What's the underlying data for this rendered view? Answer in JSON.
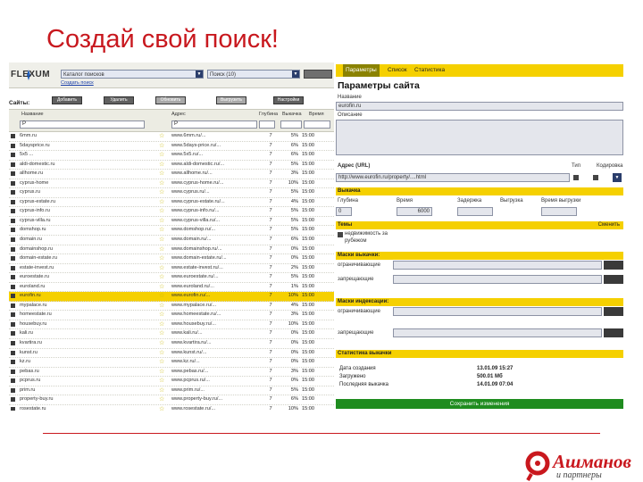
{
  "slide": {
    "title": "Создай свой поиск!"
  },
  "app": {
    "logo": "FLEXUM",
    "search_select": "Каталог поисков",
    "filter_select": "Поиск (10)",
    "go_label": "",
    "sublink": "Создать поиск"
  },
  "toolbar": {
    "label": "Сайты:",
    "buttons": [
      "Добавить",
      "Удалить",
      "Обновить",
      "Выгрузить",
      "Настройки"
    ]
  },
  "table": {
    "headers": [
      "Название",
      "Адрес",
      "Глубина",
      "Выкачка",
      "Время"
    ],
    "filter_icon": "Р",
    "rows": [
      {
        "name": "6mm.ru",
        "url": "www.6mm.ru/...",
        "count": "7",
        "pct": "5%",
        "time": "15:00"
      },
      {
        "name": "5daysprice.ru",
        "url": "www.5days-price.ru/...",
        "count": "7",
        "pct": "6%",
        "time": "15:00"
      },
      {
        "name": "5x5 ... ",
        "url": "www.5x5.ru/...",
        "count": "7",
        "pct": "6%",
        "time": "15:00"
      },
      {
        "name": "aldi-domestic.ru",
        "url": "www.aldi-domestic.ru/...",
        "count": "7",
        "pct": "5%",
        "time": "15:00"
      },
      {
        "name": "allhome.ru",
        "url": "www.allhome.ru/...",
        "count": "7",
        "pct": "3%",
        "time": "15:00"
      },
      {
        "name": "cyprus-home",
        "url": "www.cyprus-home.ru/...",
        "count": "7",
        "pct": "10%",
        "time": "15:00"
      },
      {
        "name": "cyprus.ru",
        "url": "www.cyprus.ru/...",
        "count": "7",
        "pct": "5%",
        "time": "15:00"
      },
      {
        "name": "cyprus-estate.ru",
        "url": "www.cyprus-estate.ru/...",
        "count": "7",
        "pct": "4%",
        "time": "15:00"
      },
      {
        "name": "cyprus-info.ru",
        "url": "www.cyprus-info.ru/...",
        "count": "7",
        "pct": "5%",
        "time": "15:00"
      },
      {
        "name": "cyprus-villa.ru",
        "url": "www.cyprus-villa.ru/...",
        "count": "7",
        "pct": "5%",
        "time": "15:00"
      },
      {
        "name": "domshop.ru",
        "url": "www.domshop.ru/...",
        "count": "7",
        "pct": "5%",
        "time": "15:00"
      },
      {
        "name": "domain.ru",
        "url": "www.domain.ru/...",
        "count": "7",
        "pct": "6%",
        "time": "15:00"
      },
      {
        "name": "domainshop.ru",
        "url": "www.domainshop.ru/...",
        "count": "7",
        "pct": "0%",
        "time": "15:00"
      },
      {
        "name": "domain-estate.ru",
        "url": "www.domain-estate.ru/...",
        "count": "7",
        "pct": "0%",
        "time": "15:00"
      },
      {
        "name": "estate-invest.ru",
        "url": "www.estate-invest.ru/...",
        "count": "7",
        "pct": "2%",
        "time": "15:00"
      },
      {
        "name": "euroestate.ru",
        "url": "www.euroestate.ru/...",
        "count": "7",
        "pct": "5%",
        "time": "15:00"
      },
      {
        "name": "euroland.ru",
        "url": "www.euroland.ru/...",
        "count": "7",
        "pct": "1%",
        "time": "15:00"
      },
      {
        "name": "eurofin.ru",
        "url": "www.eurofin.ru/...",
        "count": "7",
        "pct": "10%",
        "time": "15:00",
        "hl": true
      },
      {
        "name": "mypalace.ru",
        "url": "www.mypalace.ru/...",
        "count": "7",
        "pct": "4%",
        "time": "15:00"
      },
      {
        "name": "homeestate.ru",
        "url": "www.homeestate.ru/...",
        "count": "7",
        "pct": "3%",
        "time": "15:00"
      },
      {
        "name": "housebuy.ru",
        "url": "www.housebuy.ru/...",
        "count": "7",
        "pct": "10%",
        "time": "15:00"
      },
      {
        "name": "kali.ru",
        "url": "www.kali.ru/...",
        "count": "7",
        "pct": "0%",
        "time": "15:00"
      },
      {
        "name": "kvartira.ru",
        "url": "www.kvartira.ru/...",
        "count": "7",
        "pct": "0%",
        "time": "15:00"
      },
      {
        "name": "kunst.ru",
        "url": "www.kunst.ru/...",
        "count": "7",
        "pct": "0%",
        "time": "15:00"
      },
      {
        "name": "kz.ru",
        "url": "www.kz.ru/...",
        "count": "7",
        "pct": "0%",
        "time": "15:00"
      },
      {
        "name": "pebas.ru",
        "url": "www.pebas.ru/...",
        "count": "7",
        "pct": "3%",
        "time": "15:00"
      },
      {
        "name": "pcprus.ru",
        "url": "www.pcprus.ru/...",
        "count": "7",
        "pct": "0%",
        "time": "15:00"
      },
      {
        "name": "prim.ru",
        "url": "www.prim.ru/...",
        "count": "7",
        "pct": "5%",
        "time": "15:00"
      },
      {
        "name": "property-buy.ru",
        "url": "www.property-buy.ru/...",
        "count": "7",
        "pct": "6%",
        "time": "15:00"
      },
      {
        "name": "rosestate.ru",
        "url": "www.rosestate.ru/...",
        "count": "7",
        "pct": "10%",
        "time": "15:00"
      },
      {
        "name": "villaestate.ru",
        "url": "www.villaestate.ru/...",
        "count": "7",
        "pct": "0%",
        "time": "15:00"
      }
    ]
  },
  "panel": {
    "tabs": [
      "Параметры",
      "Список",
      "Статистика"
    ],
    "title": "Параметры сайта",
    "name_label": "Название",
    "name_value": "eurofin.ru",
    "desc_label": "Описание",
    "addr_label": "Адрес (URL)",
    "addr_value": "http://www.eurofin.ru/property/....html",
    "addr_right1": "Тип",
    "addr_right2": "Кодировка",
    "section_fetch": "Выкачка",
    "fetch_labels": [
      "Глубина",
      "Время",
      "Задержка",
      "Выгрузка",
      "Время выгрузки"
    ],
    "fetch_values": [
      "0",
      "6000",
      "",
      ""
    ],
    "section_theme": "Темы",
    "theme_right": "Сменить",
    "theme_opt1": "недвижимость за",
    "theme_opt2": "рубежом",
    "section_fetch_masks": "Маски выкачки:",
    "mask_labels": [
      "ограничивающие",
      "запрещающие"
    ],
    "section_index_masks": "Маски индексации:",
    "section_stats": "Статистика выкачки",
    "stats": [
      {
        "label": "Дата создания",
        "value": "13.01.09 15:27"
      },
      {
        "label": "Загружено",
        "value": "500.01 Мб"
      },
      {
        "label": "Последняя выкачка",
        "value": "14.01.09 07:04"
      }
    ],
    "save_label": "Сохранить изменения"
  },
  "brand": {
    "name": "Ашманов",
    "sub": "и партнеры"
  },
  "colors": {
    "accent": "#c9181e",
    "panel_yellow": "#f5d000",
    "save_green": "#1f8c1f"
  }
}
